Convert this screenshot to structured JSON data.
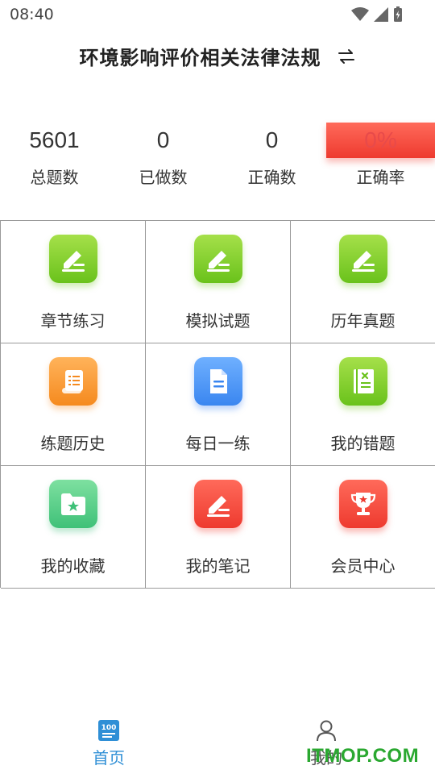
{
  "status_bar": {
    "time": "08:40"
  },
  "header": {
    "title": "环境影响评价相关法律法规"
  },
  "stats": [
    {
      "value": "5601",
      "label": "总题数"
    },
    {
      "value": "0",
      "label": "已做数"
    },
    {
      "value": "0",
      "label": "正确数"
    },
    {
      "value": "0%",
      "label": "正确率"
    }
  ],
  "grid": [
    {
      "label": "章节练习",
      "icon": "pen-icon",
      "color": "#7ccf2a"
    },
    {
      "label": "模拟试题",
      "icon": "pen-icon",
      "color": "#7ccf2a"
    },
    {
      "label": "历年真题",
      "icon": "pen-icon",
      "color": "#7ccf2a"
    },
    {
      "label": "练题历史",
      "icon": "scroll-icon",
      "color": "#f8962e"
    },
    {
      "label": "每日一练",
      "icon": "document-icon",
      "color": "#4a93f5"
    },
    {
      "label": "我的错题",
      "icon": "wrong-book-icon",
      "color": "#7ccf2a"
    },
    {
      "label": "我的收藏",
      "icon": "star-folder-icon",
      "color": "#4ccb86"
    },
    {
      "label": "我的笔记",
      "icon": "pen-icon",
      "color": "#f24a3c"
    },
    {
      "label": "会员中心",
      "icon": "trophy-icon",
      "color": "#f24a3c"
    }
  ],
  "bottom_nav": [
    {
      "label": "首页",
      "icon": "home-100-icon",
      "active": true
    },
    {
      "label": "我的",
      "icon": "user-icon",
      "active": false
    }
  ],
  "accent_color": "#2f8fd6",
  "watermark": "ITMOP.COM"
}
